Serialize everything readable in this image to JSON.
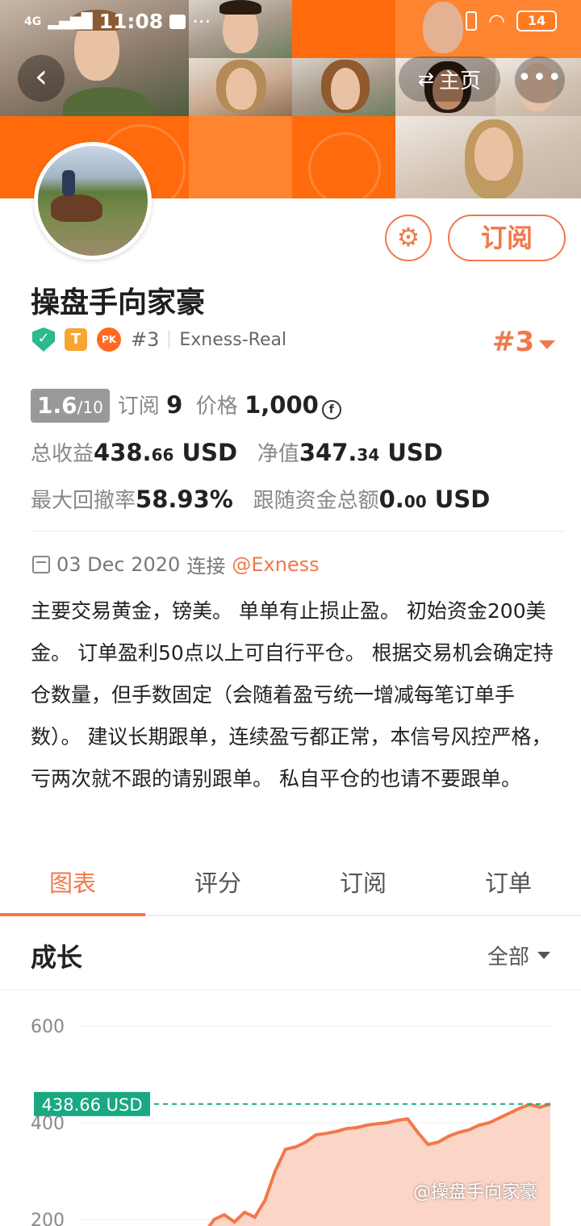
{
  "status_bar": {
    "network": "4G",
    "time": "11:08",
    "more": "···",
    "battery": "14"
  },
  "nav": {
    "home_label": "主页"
  },
  "profile": {
    "name": "操盘手向家豪",
    "subscribe_label": "订阅",
    "badge_t": "T",
    "badge_pk": "PK",
    "rank_small": "#3",
    "broker": "Exness-Real",
    "rank_big": "#3"
  },
  "stats": {
    "score_main": "1.6",
    "score_den": "/10",
    "subs_label": "订阅",
    "subs_value": "9",
    "price_label": "价格",
    "price_value": "1,000",
    "total_profit_label": "总收益",
    "total_profit_int": "438.",
    "total_profit_dec": "66",
    "total_profit_unit": "USD",
    "equity_label": "净值",
    "equity_int": "347.",
    "equity_dec": "34",
    "equity_unit": "USD",
    "drawdown_label": "最大回撤率",
    "drawdown_value": "58.93%",
    "follow_label": "跟随资金总额",
    "follow_int": "0.",
    "follow_dec": "00",
    "follow_unit": "USD"
  },
  "connection": {
    "date": "03 Dec 2020",
    "text": "连接",
    "link": "@Exness"
  },
  "description": "主要交易黄金，镑美。 单单有止损止盈。 初始资金200美金。 订单盈利50点以上可自行平仓。 根据交易机会确定持仓数量，但手数固定（会随着盈亏统一增减每笔订单手数）。 建议长期跟单，连续盈亏都正常，本信号风控严格，亏两次就不跟的请别跟单。 私自平仓的也请不要跟单。",
  "tabs": [
    {
      "label": "图表"
    },
    {
      "label": "评分"
    },
    {
      "label": "订阅"
    },
    {
      "label": "订单"
    }
  ],
  "section": {
    "title": "成长",
    "filter": "全部"
  },
  "chart_data": {
    "type": "area",
    "y_ticks": [
      "600",
      "400",
      "200"
    ],
    "ylim": [
      200,
      600
    ],
    "current_label": "438.66 USD",
    "current_value": 438.66,
    "values": [
      155,
      170,
      200,
      210,
      195,
      215,
      205,
      240,
      300,
      345,
      350,
      360,
      375,
      378,
      382,
      388,
      390,
      395,
      398,
      400,
      405,
      408,
      380,
      355,
      360,
      372,
      380,
      385,
      395,
      400,
      410,
      420,
      430,
      438,
      432,
      438.66
    ],
    "color": "#f2784b",
    "fill": "#fbd6c6",
    "ref_line_color": "#1aa883"
  },
  "watermark": "@操盘手向家豪",
  "colors": {
    "accent": "#f2784b",
    "banner": "#ff7a1f",
    "teal": "#1aa883"
  }
}
